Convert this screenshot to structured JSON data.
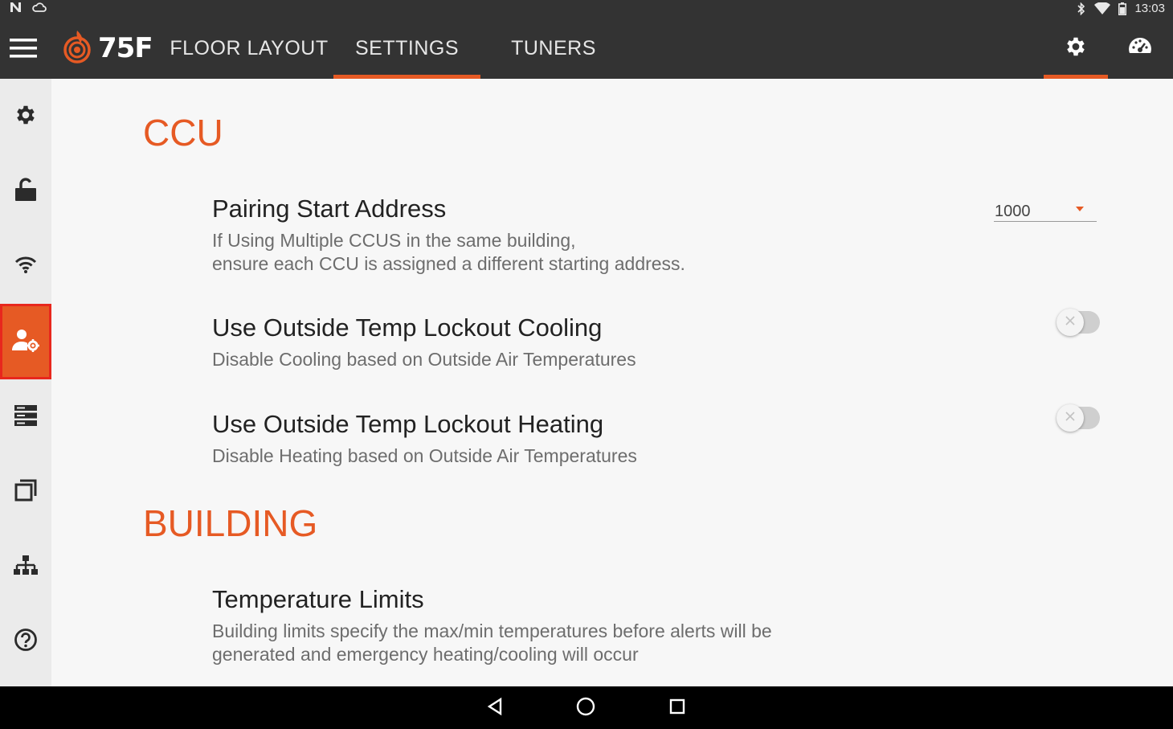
{
  "status_bar": {
    "time": "13:03",
    "left_icons": [
      "n-notification-icon",
      "cloud-icon"
    ],
    "right_icons": [
      "bluetooth-icon",
      "wifi-signal-icon",
      "battery-icon"
    ]
  },
  "app_bar": {
    "logo_text": "75F",
    "tabs": [
      {
        "label": "FLOOR LAYOUT",
        "active": false
      },
      {
        "label": "SETTINGS",
        "active": true
      },
      {
        "label": "TUNERS",
        "active": false
      }
    ],
    "right_icons": [
      "gear-icon",
      "dashboard-icon"
    ]
  },
  "rail": {
    "items": [
      {
        "icon": "gear-icon",
        "active": false
      },
      {
        "icon": "unlock-icon",
        "active": false
      },
      {
        "icon": "wifi-icon",
        "active": false
      },
      {
        "icon": "user-settings-icon",
        "active": true
      },
      {
        "icon": "server-icon",
        "active": false
      },
      {
        "icon": "copy-icon",
        "active": false
      },
      {
        "icon": "network-icon",
        "active": false
      },
      {
        "icon": "help-icon",
        "active": false
      }
    ]
  },
  "main": {
    "sections": {
      "ccu": {
        "title": "CCU"
      },
      "building": {
        "title": "BUILDING"
      }
    },
    "pairing": {
      "title": "Pairing Start Address",
      "description": "If Using Multiple CCUS in the same building,\nensure each CCU is assigned a different starting address.",
      "value": "1000"
    },
    "lockout_cooling": {
      "title": "Use Outside Temp Lockout Cooling",
      "description": "Disable Cooling based on Outside Air Temperatures",
      "enabled": false
    },
    "lockout_heating": {
      "title": "Use Outside Temp Lockout Heating",
      "description": "Disable Heating based on Outside Air Temperatures",
      "enabled": false
    },
    "temperature_limits": {
      "title": "Temperature Limits",
      "description": "Building limits specify the max/min temperatures before alerts will be\ngenerated and emergency heating/cooling will occur"
    }
  },
  "colors": {
    "accent": "#e65a24",
    "app_bar": "#333333",
    "rail_bg": "#ebebeb",
    "content_bg": "#f7f7f7"
  }
}
